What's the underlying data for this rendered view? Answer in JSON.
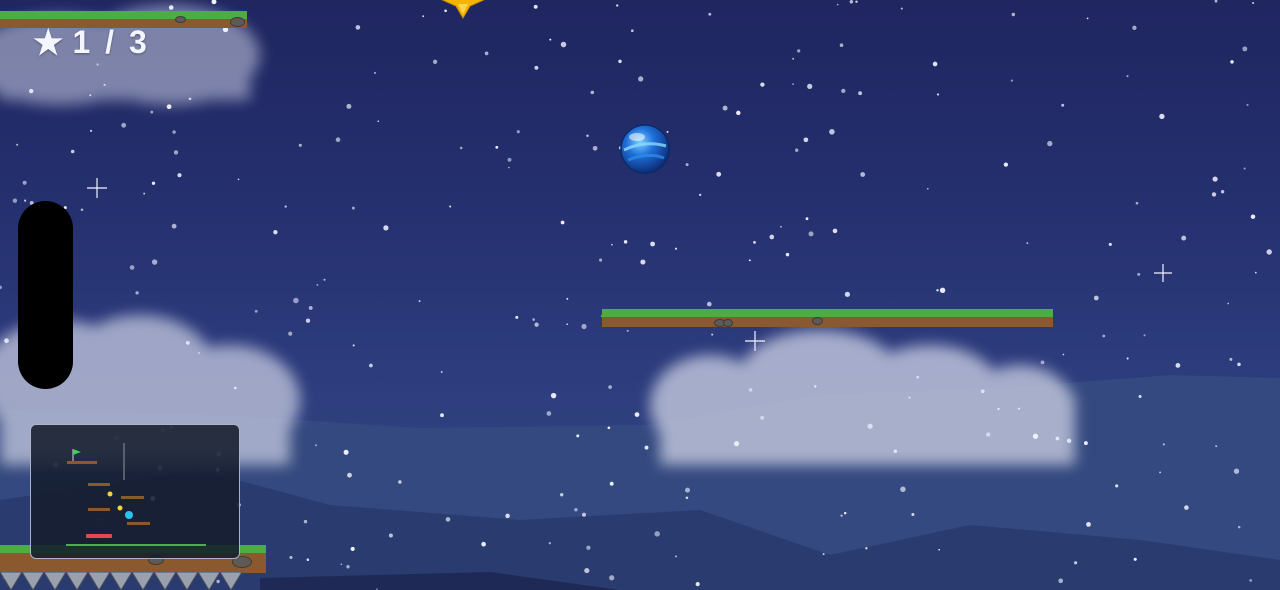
{
  "hud": {
    "star_icon": "★",
    "star_count": "1 / 3",
    "star_icon_name": "star-icon"
  },
  "colors": {
    "sky_top": "#1f2660",
    "sky_bottom": "#344a85",
    "grass": "#4fac45",
    "dirt": "#8a5a2e",
    "ball": "#1e6fd9",
    "star": "#f5b400",
    "minimap_player": "#29c3f0",
    "minimap_star": "#f4d23a",
    "minimap_hazard": "#e8474f",
    "minimap_flag": "#3fcf5a"
  },
  "game": {
    "player": "blue-glass-ball",
    "collectible": "gold-star",
    "hazard": "spike-row",
    "background": "night-sky-with-snow"
  }
}
